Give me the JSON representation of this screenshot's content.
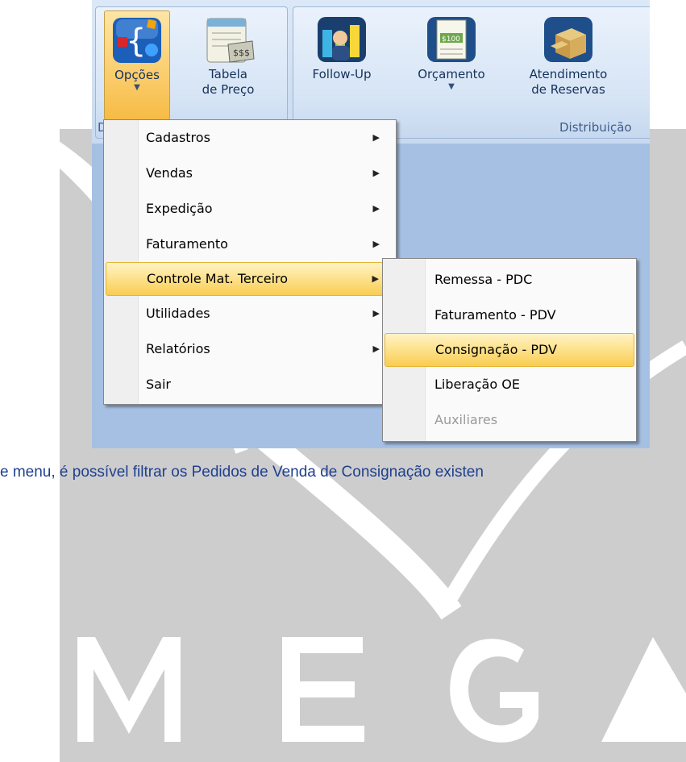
{
  "watermark": {
    "text": "MEGA"
  },
  "ribbon": {
    "group1": {
      "caption": "D",
      "buttons": [
        {
          "label": "Opções",
          "icon": "options-icon",
          "has_dropdown": true
        },
        {
          "label_line1": "Tabela",
          "label_line2": "de Preço",
          "icon": "price-table-icon"
        }
      ]
    },
    "group2": {
      "caption": "Distribuição",
      "buttons": [
        {
          "label": "Follow-Up",
          "icon": "follow-up-icon"
        },
        {
          "label": "Orçamento",
          "icon": "budget-icon",
          "has_dropdown": true
        },
        {
          "label_line1": "Atendimento",
          "label_line2": "de Reservas",
          "icon": "reservations-icon"
        }
      ]
    }
  },
  "menu": {
    "items": [
      {
        "label": "Cadastros",
        "has_submenu": true
      },
      {
        "label": "Vendas",
        "has_submenu": true
      },
      {
        "label": "Expedição",
        "has_submenu": true
      },
      {
        "label": "Faturamento",
        "has_submenu": true
      },
      {
        "label": "Controle Mat. Terceiro",
        "has_submenu": true,
        "highlighted": true
      },
      {
        "label": "Utilidades",
        "has_submenu": true
      },
      {
        "label": "Relatórios",
        "has_submenu": true
      },
      {
        "label": "Sair",
        "has_submenu": false
      }
    ],
    "submenu_arrow": "▶"
  },
  "submenu": {
    "items": [
      {
        "label": "Remessa - PDC"
      },
      {
        "label": "Faturamento - PDV"
      },
      {
        "label": "Consignação - PDV",
        "highlighted": true
      },
      {
        "label": "Liberação OE"
      },
      {
        "label": "Auxiliares",
        "disabled": true
      }
    ]
  },
  "caption": "e menu, é possível filtrar os Pedidos de Venda de Consignação existen",
  "colors": {
    "highlight": "#fbd37a",
    "caption_text": "#1f3f8f",
    "watermark": "#cdcdcd"
  }
}
